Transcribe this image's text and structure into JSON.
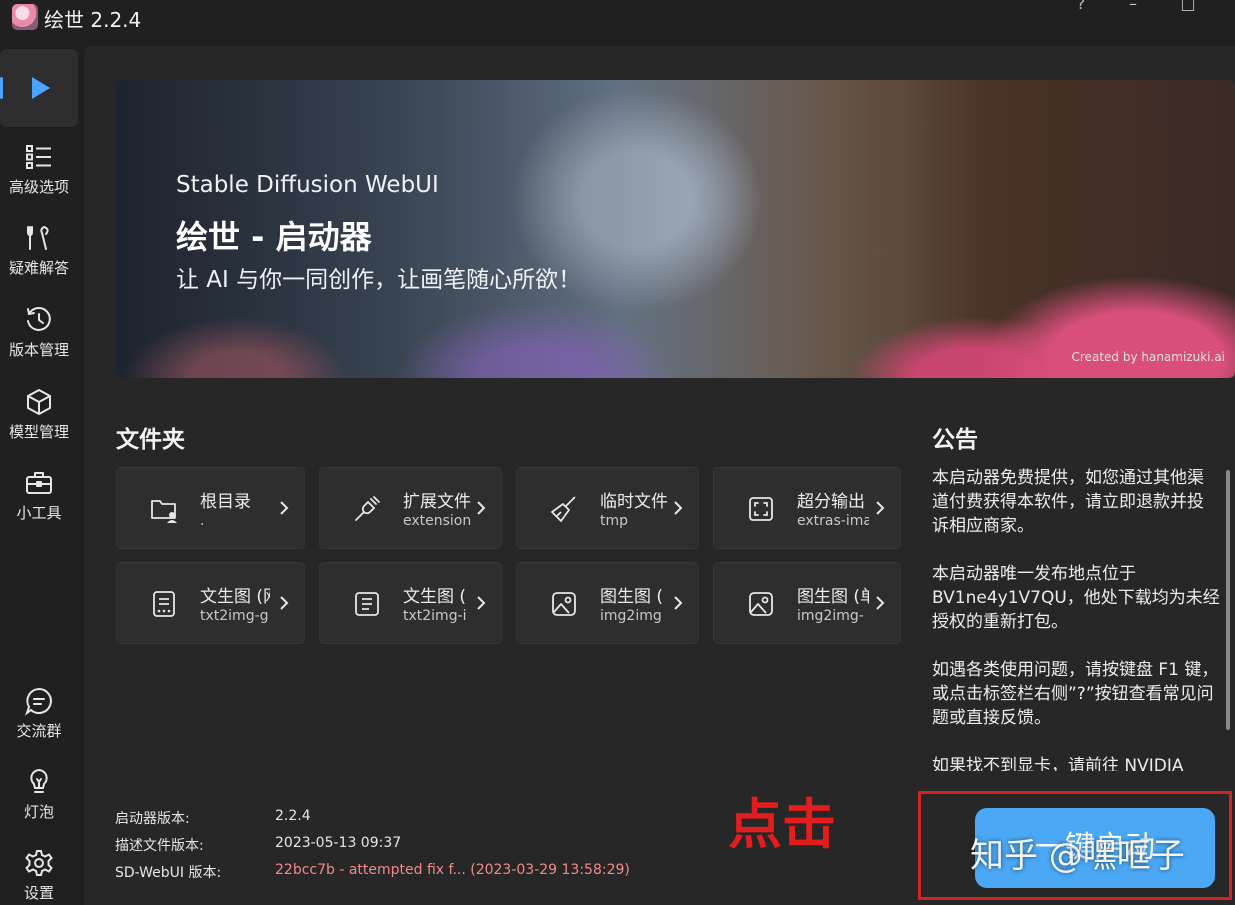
{
  "window": {
    "title": "绘世 2.2.4",
    "buttons": [
      "?",
      "–",
      "□"
    ]
  },
  "sidebar": {
    "items": [
      {
        "label": "",
        "icon": "play-icon"
      },
      {
        "label": "高级选项",
        "icon": "list-icon"
      },
      {
        "label": "疑难解答",
        "icon": "wrench-icon"
      },
      {
        "label": "版本管理",
        "icon": "history-icon"
      },
      {
        "label": "模型管理",
        "icon": "cube-icon"
      },
      {
        "label": "小工具",
        "icon": "toolbox-icon"
      },
      {
        "label": "交流群",
        "icon": "chat-icon"
      },
      {
        "label": "灯泡",
        "icon": "bulb-icon"
      },
      {
        "label": "设置",
        "icon": "gear-icon"
      }
    ],
    "accent": "#4aa3ff"
  },
  "banner": {
    "subtitle": "Stable Diffusion WebUI",
    "title": "绘世 - 启动器",
    "tagline": "让 AI 与你一同创作，让画笔随心所欲！",
    "credit": "Created by hanamizuki.ai"
  },
  "folders": {
    "title": "文件夹",
    "items": [
      {
        "name": "根目录",
        "path": ".",
        "icon": "folder-user-icon"
      },
      {
        "name": "扩展文件",
        "path": "extension",
        "icon": "plug-icon"
      },
      {
        "name": "临时文件",
        "path": "tmp",
        "icon": "broom-icon"
      },
      {
        "name": "超分输出",
        "path": "extras-ima",
        "icon": "upscale-icon"
      },
      {
        "name": "文生图 (网",
        "path": "txt2img-g",
        "icon": "grid-doc-icon"
      },
      {
        "name": "文生图 (",
        "path": "txt2img-i",
        "icon": "doc-icon"
      },
      {
        "name": "图生图 (",
        "path": "img2img",
        "icon": "image-icon"
      },
      {
        "name": "图生图 (单",
        "path": "img2img-",
        "icon": "image-icon"
      }
    ]
  },
  "notice": {
    "title": "公告",
    "paragraphs": [
      "本启动器免费提供，如您通过其他渠道付费获得本软件，请立即退款并投诉相应商家。",
      "本启动器唯一发布地点位于 BV1ne4y1V7QU，他处下载均为未经授权的重新打包。",
      "如遇各类使用问题，请按键盘 F1 键，或点击标签栏右侧”?”按钮查看常见问题或直接反馈。",
      "如果找不到显卡，请前往 NVIDIA"
    ]
  },
  "versions": {
    "launcher_label": "启动器版本:",
    "launcher_value": "2.2.4",
    "descriptor_label": "描述文件版本:",
    "descriptor_value": "2023-05-13 09:37",
    "webui_label": "SD-WebUI 版本:",
    "webui_value": "22bcc7b - attempted fix f... (2023-03-29 13:58:29)"
  },
  "annotation": {
    "click_hint": "点击",
    "launch_button": "一键启动",
    "watermark": "知乎 @嘿哐子"
  },
  "colors": {
    "background": "#202020",
    "content": "#272727",
    "card": "#2e2e2e",
    "launch_button": "#4ba8f5",
    "highlight": "#d42121",
    "warning_text": "#f28a8a"
  }
}
